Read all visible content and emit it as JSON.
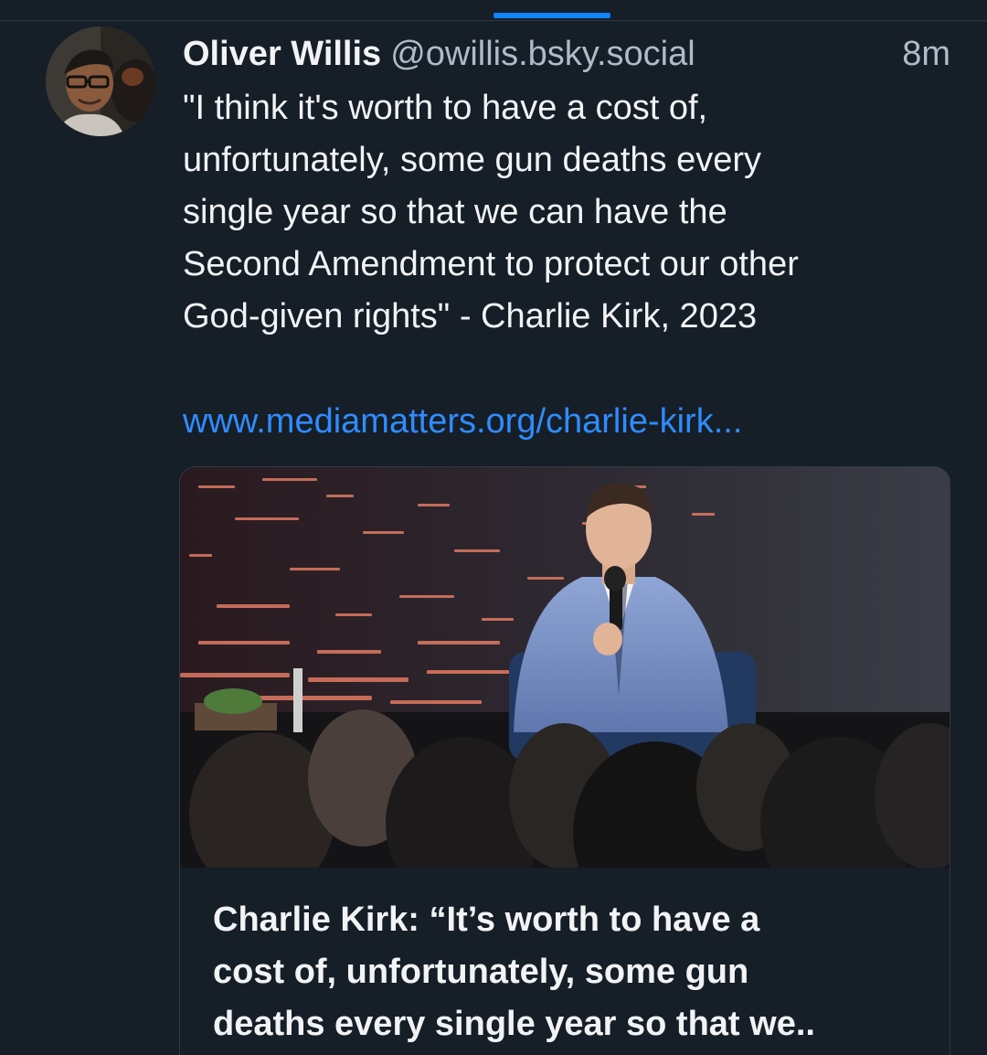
{
  "post": {
    "author": {
      "display_name": "Oliver Willis",
      "handle": "@owillis.bsky.social"
    },
    "timestamp": "8m",
    "text_lines": [
      "\"I think it's worth to have a cost of,",
      "unfortunately, some gun deaths every",
      "single year so that we can have the",
      "Second Amendment to protect our other",
      "God-given rights\" - Charlie Kirk, 2023"
    ],
    "link_text": "www.mediamatters.org/charlie-kirk...",
    "embed": {
      "title_lines": [
        "Charlie Kirk: “It’s worth to have a",
        "cost of, unfortunately, some gun",
        "deaths every single year so that we.."
      ]
    }
  },
  "colors": {
    "background": "#161e27",
    "accent": "#1083fe",
    "link": "#2f8cff",
    "secondary_text": "#aebbc9"
  }
}
